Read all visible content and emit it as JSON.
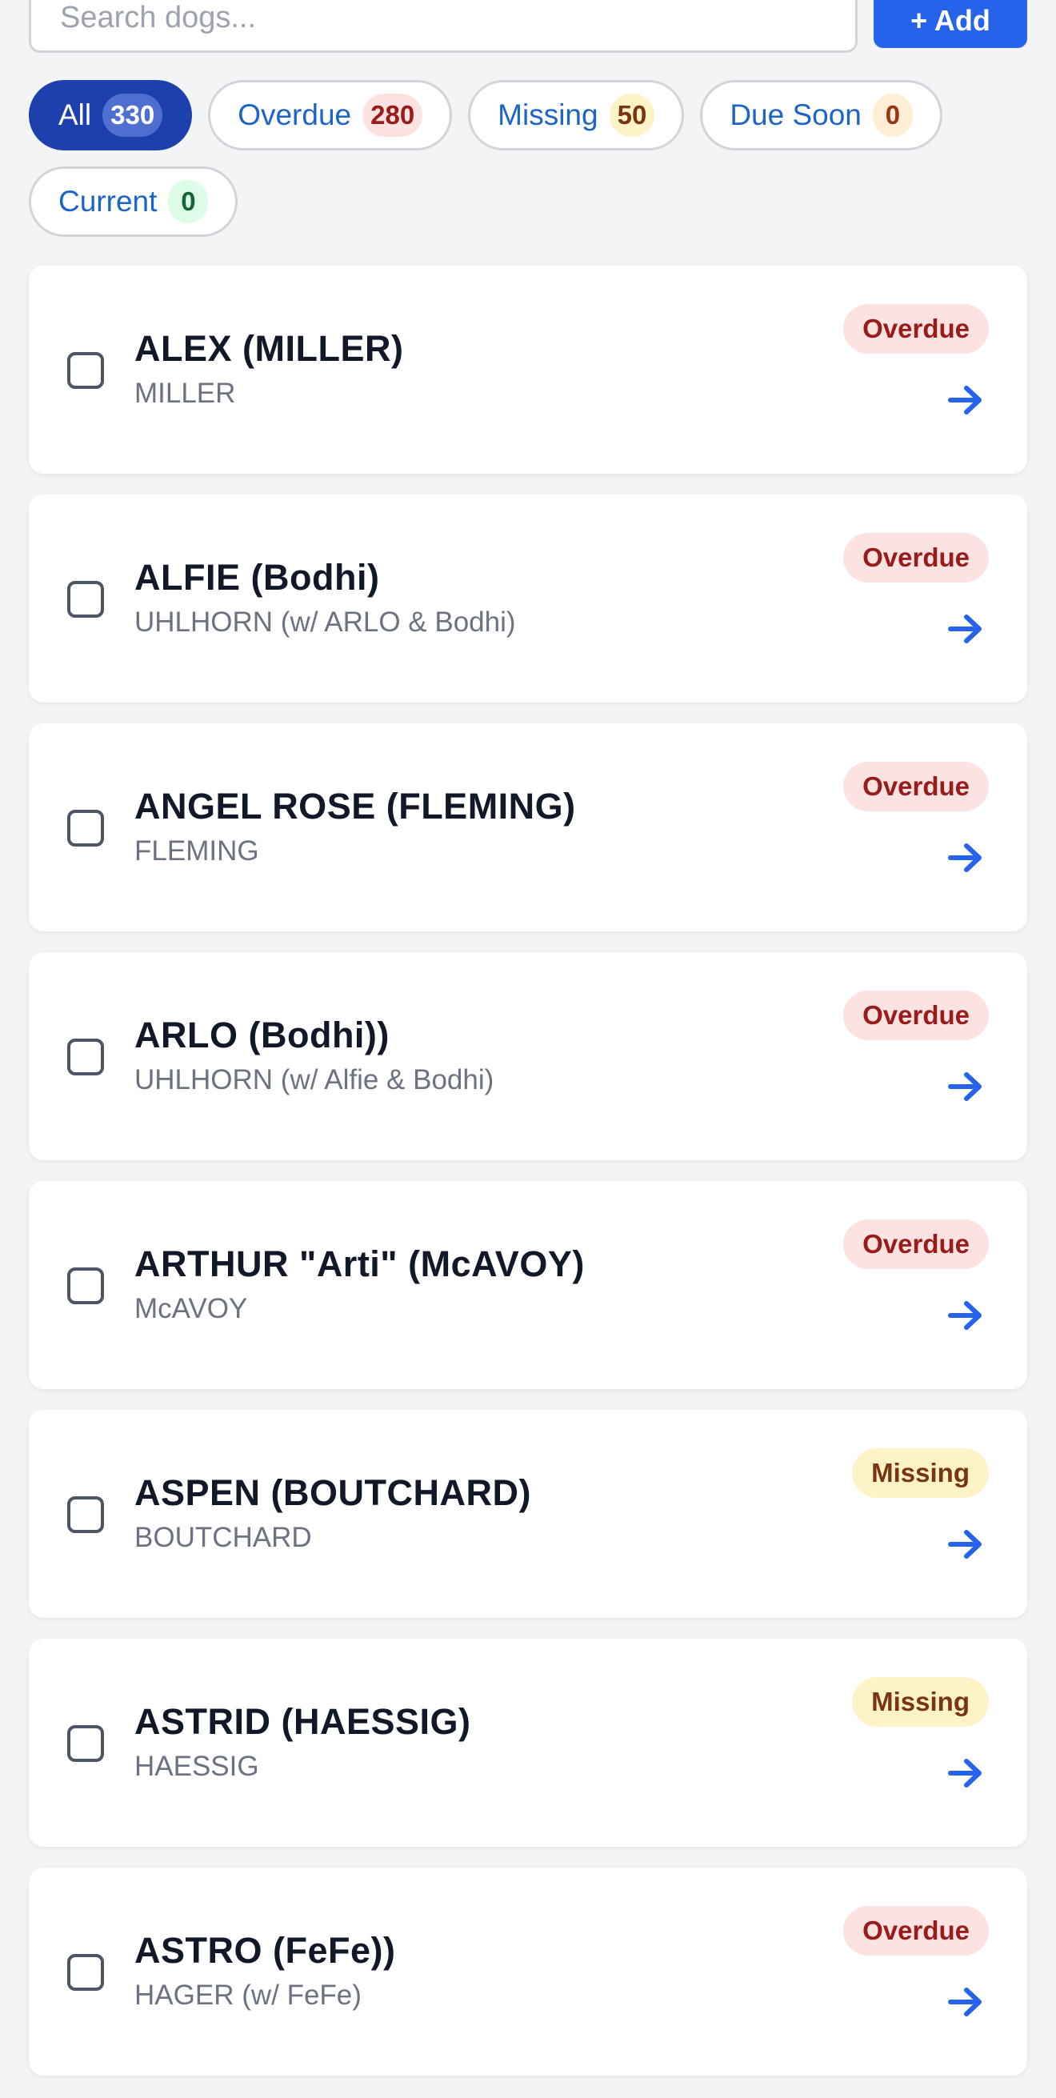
{
  "search": {
    "placeholder": "Search dogs...",
    "value": ""
  },
  "add_button": {
    "label": "+ Add"
  },
  "filters": [
    {
      "label": "All",
      "count": "330",
      "active": true,
      "count_color": "active"
    },
    {
      "label": "Overdue",
      "count": "280",
      "active": false,
      "count_color": "red"
    },
    {
      "label": "Missing",
      "count": "50",
      "active": false,
      "count_color": "yellow"
    },
    {
      "label": "Due Soon",
      "count": "0",
      "active": false,
      "count_color": "orange"
    },
    {
      "label": "Current",
      "count": "0",
      "active": false,
      "count_color": "green"
    }
  ],
  "dogs": [
    {
      "name": "ALEX (MILLER)",
      "owner": "MILLER",
      "status": "Overdue"
    },
    {
      "name": "ALFIE (Bodhi)",
      "owner": "UHLHORN (w/ ARLO & Bodhi)",
      "status": "Overdue"
    },
    {
      "name": "ANGEL ROSE (FLEMING)",
      "owner": "FLEMING",
      "status": "Overdue"
    },
    {
      "name": "ARLO (Bodhi))",
      "owner": "UHLHORN (w/ Alfie & Bodhi)",
      "status": "Overdue"
    },
    {
      "name": "ARTHUR \"Arti\" (McAVOY)",
      "owner": "McAVOY",
      "status": "Overdue"
    },
    {
      "name": "ASPEN (BOUTCHARD)",
      "owner": "BOUTCHARD",
      "status": "Missing"
    },
    {
      "name": "ASTRID (HAESSIG)",
      "owner": "HAESSIG",
      "status": "Missing"
    },
    {
      "name": "ASTRO (FeFe))",
      "owner": "HAGER (w/ FeFe)",
      "status": "Overdue"
    }
  ],
  "colors": {
    "accent": "#2563eb",
    "active_chip": "#1e40af",
    "overdue_bg": "#fde2e2",
    "overdue_text": "#991b1b",
    "missing_bg": "#fef3c7",
    "missing_text": "#78350f"
  },
  "icons": {
    "row_action": "arrow-right-icon"
  }
}
